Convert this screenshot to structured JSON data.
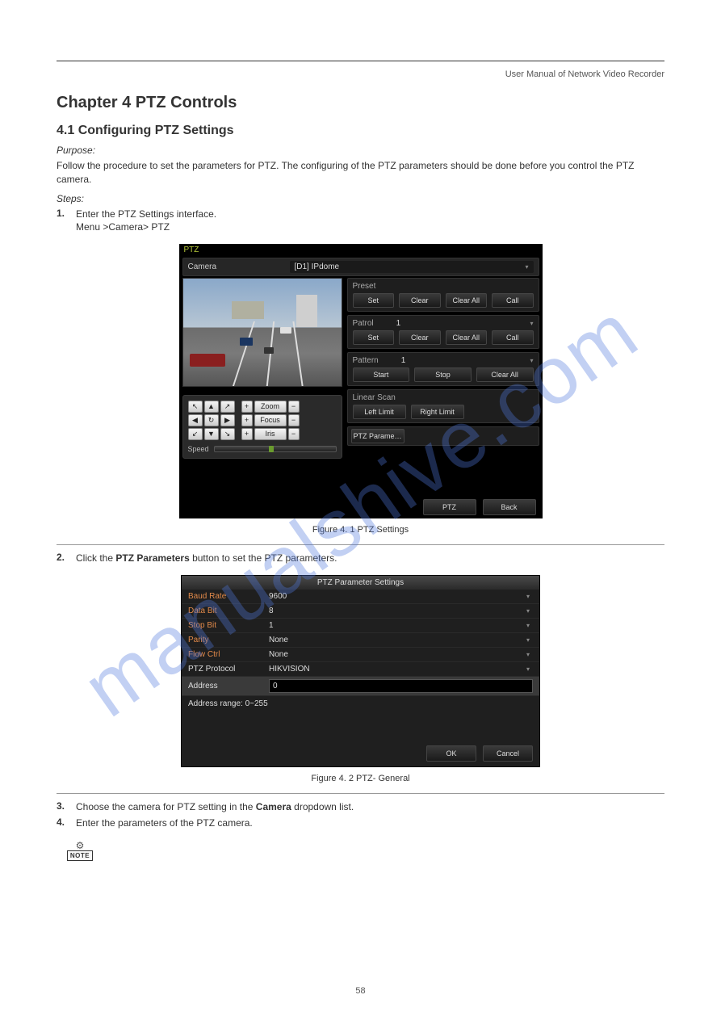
{
  "header": "User Manual of Network Video Recorder",
  "chapter_title": "Chapter 4 PTZ Controls",
  "section_title": "4.1 Configuring PTZ Settings",
  "purpose_label": "Purpose:",
  "purpose_text": "Follow the procedure to set the parameters for PTZ. The configuring of the PTZ parameters should be done before you control the PTZ camera.",
  "steps_label": "Steps:",
  "step1_num": "1.",
  "step1_text": "Enter the PTZ Settings interface.",
  "step1_path": "Menu >Camera> PTZ",
  "fig1_caption": "Figure 4. 1 PTZ Settings",
  "step2_num": "2.",
  "step2_text_a": "Click the ",
  "step2_text_b": "PTZ Parameters",
  "step2_text_c": " button to set the PTZ parameters.",
  "fig2_caption": "Figure 4. 2 PTZ- General",
  "step3_num": "3.",
  "step3_text_a": "Choose the camera for PTZ setting in the ",
  "step3_text_b": "Camera",
  "step3_text_c": " dropdown list.",
  "step4_num": "4.",
  "step4_text": "Enter the parameters of the PTZ camera.",
  "page_number": "58",
  "watermark": "manualshive.com",
  "ptz": {
    "title": "PTZ",
    "camera_label": "Camera",
    "camera_value": "[D1] IPdome",
    "preset_label": "Preset",
    "patrol_label": "Patrol",
    "patrol_value": "1",
    "pattern_label": "Pattern",
    "pattern_value": "1",
    "linear_label": "Linear Scan",
    "set": "Set",
    "clear": "Clear",
    "clearall": "Clear All",
    "call": "Call",
    "start": "Start",
    "stop": "Stop",
    "leftlimit": "Left Limit",
    "rightlimit": "Right Limit",
    "ptzparam": "PTZ Parame…",
    "zoom": "Zoom",
    "focus": "Focus",
    "iris": "Iris",
    "speed": "Speed",
    "footer_ptz": "PTZ",
    "footer_back": "Back"
  },
  "param": {
    "title": "PTZ Parameter Settings",
    "baud_label": "Baud Rate",
    "baud_value": "9600",
    "databit_label": "Data Bit",
    "databit_value": "8",
    "stopbit_label": "Stop Bit",
    "stopbit_value": "1",
    "parity_label": "Parity",
    "parity_value": "None",
    "flow_label": "Flow Ctrl",
    "flow_value": "None",
    "protocol_label": "PTZ Protocol",
    "protocol_value": "HIKVISION",
    "address_label": "Address",
    "address_value": "0",
    "addr_range": "Address range: 0~255",
    "ok": "OK",
    "cancel": "Cancel"
  },
  "note_label": "NOTE"
}
